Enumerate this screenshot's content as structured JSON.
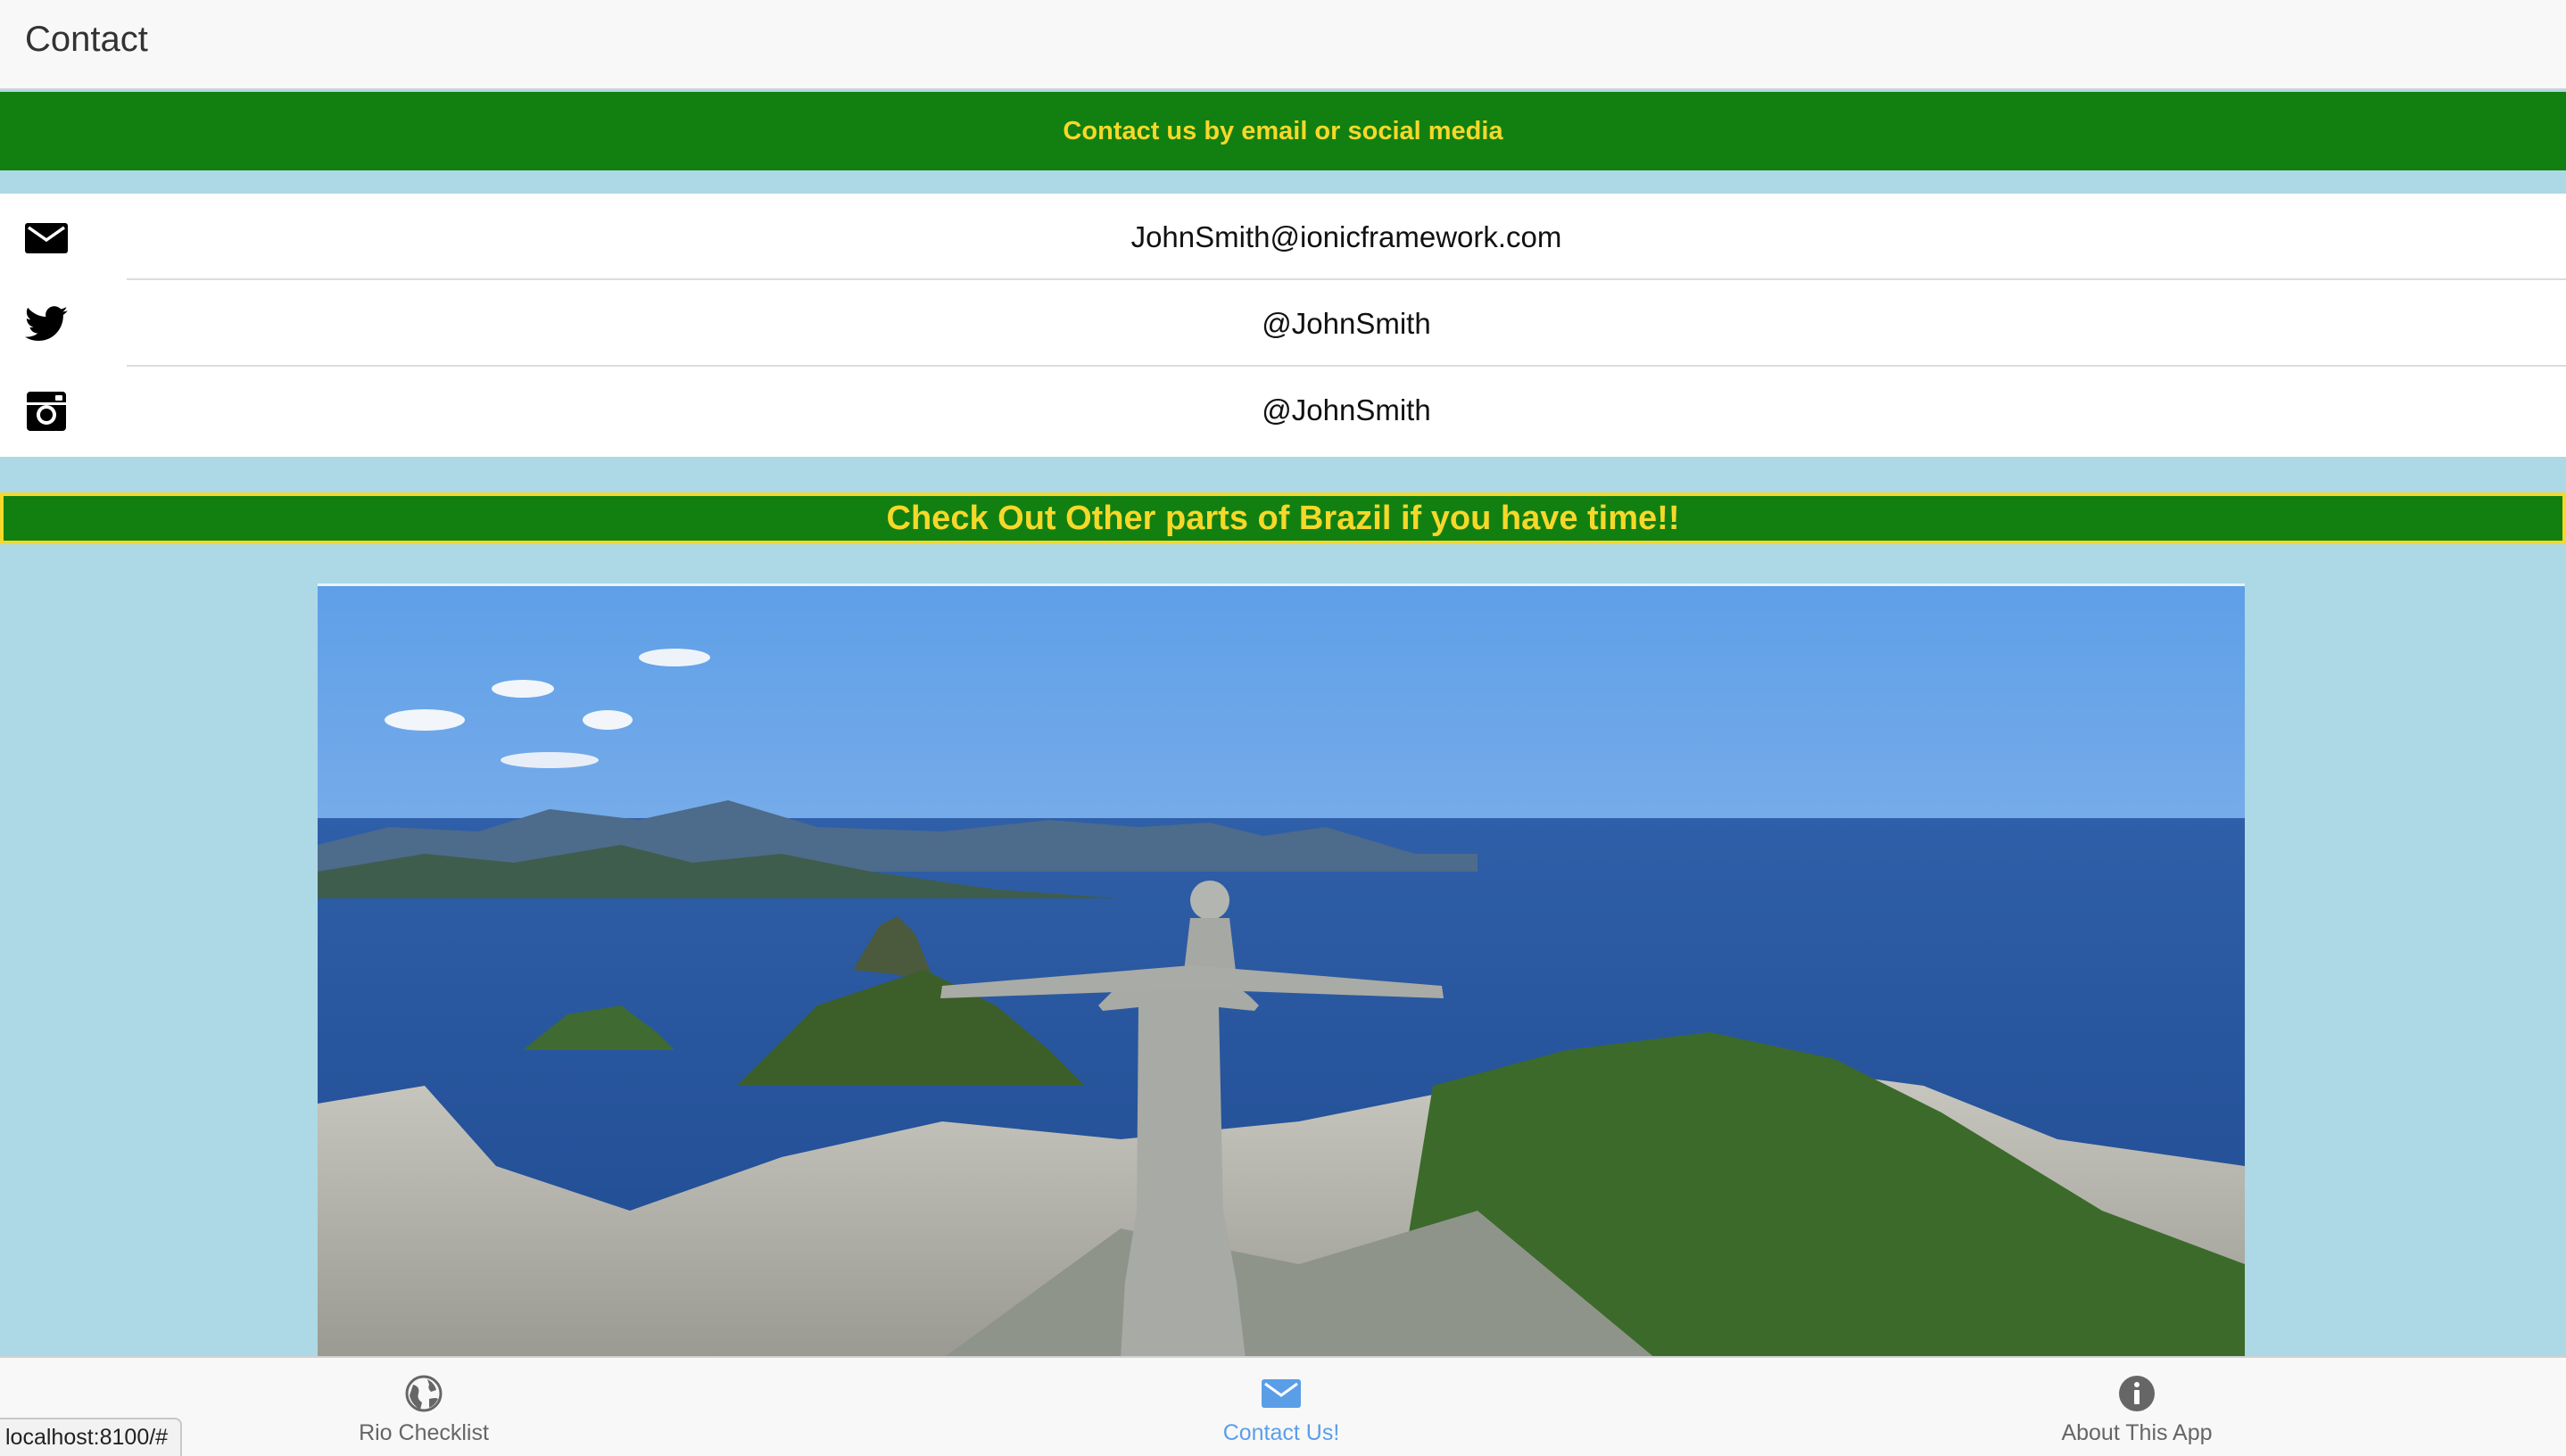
{
  "header": {
    "title": "Contact"
  },
  "contact_banner": {
    "text": "Contact us by email or social media"
  },
  "contacts": [
    {
      "icon": "mail-icon",
      "text": "JohnSmith@ionicframework.com"
    },
    {
      "icon": "twitter-icon",
      "text": "@JohnSmith"
    },
    {
      "icon": "instagram-icon",
      "text": "@JohnSmith"
    }
  ],
  "promo_banner": {
    "text": "Check Out Other parts of Brazil if you have time!!"
  },
  "tabs": [
    {
      "icon": "globe-icon",
      "label": "Rio Checklist",
      "active": false
    },
    {
      "icon": "mail-icon",
      "label": "Contact Us!",
      "active": true
    },
    {
      "icon": "info-icon",
      "label": "About This App",
      "active": false
    }
  ],
  "status_bar": {
    "url": "localhost:8100/#"
  },
  "colors": {
    "brand_green": "#118010",
    "brand_yellow": "#f6d82a",
    "background": "#add8e6",
    "active_tab": "#5b9ee8"
  }
}
